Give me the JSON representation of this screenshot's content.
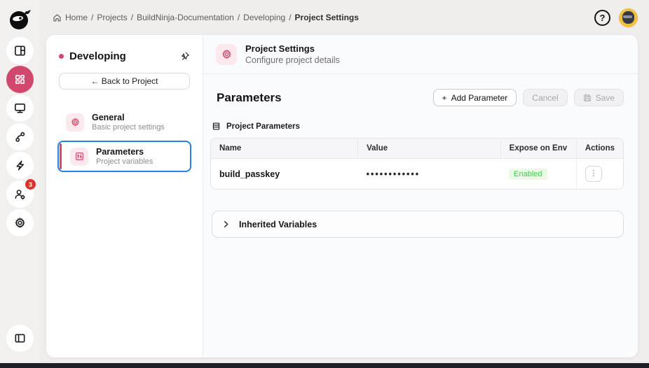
{
  "brand": {
    "accent_color": "#d2486c",
    "focus_color": "#2383e2",
    "enabled_color": "#42c94d"
  },
  "breadcrumb": {
    "separator": "/",
    "items": [
      "Home",
      "Projects",
      "BuildNinja-Documentation",
      "Developing",
      "Project Settings"
    ]
  },
  "topbar": {
    "help_label": "?",
    "notifications_badge": "3"
  },
  "left_rail": {
    "items": [
      {
        "name": "dashboard-layout"
      },
      {
        "name": "apps-grid",
        "active": true
      },
      {
        "name": "desktop"
      },
      {
        "name": "git-branch"
      },
      {
        "name": "automations"
      },
      {
        "name": "users",
        "badge": "3"
      },
      {
        "name": "settings"
      }
    ],
    "bottom_item": {
      "name": "collapse-panel"
    }
  },
  "subsidebar": {
    "title": "Developing",
    "back_button": "← Back to Project",
    "nav": [
      {
        "title": "General",
        "subtitle": "Basic project settings"
      },
      {
        "title": "Parameters",
        "subtitle": "Project variables",
        "selected": true
      }
    ]
  },
  "main": {
    "header": {
      "title": "Project Settings",
      "subtitle": "Configure project details"
    },
    "section_title": "Parameters",
    "toolbar": {
      "plus": "+",
      "add_label": "Add Parameter",
      "cancel_label": "Cancel",
      "save_label": "Save"
    },
    "table_label": "Project Parameters",
    "table": {
      "columns": [
        "Name",
        "Value",
        "Expose on Env",
        "Actions"
      ],
      "rows": [
        {
          "name": "build_passkey",
          "value_masked": "••••••••••••",
          "expose_status": "Enabled",
          "kebab": "⋮"
        }
      ]
    },
    "inherited": {
      "label": "Inherited Variables"
    }
  }
}
